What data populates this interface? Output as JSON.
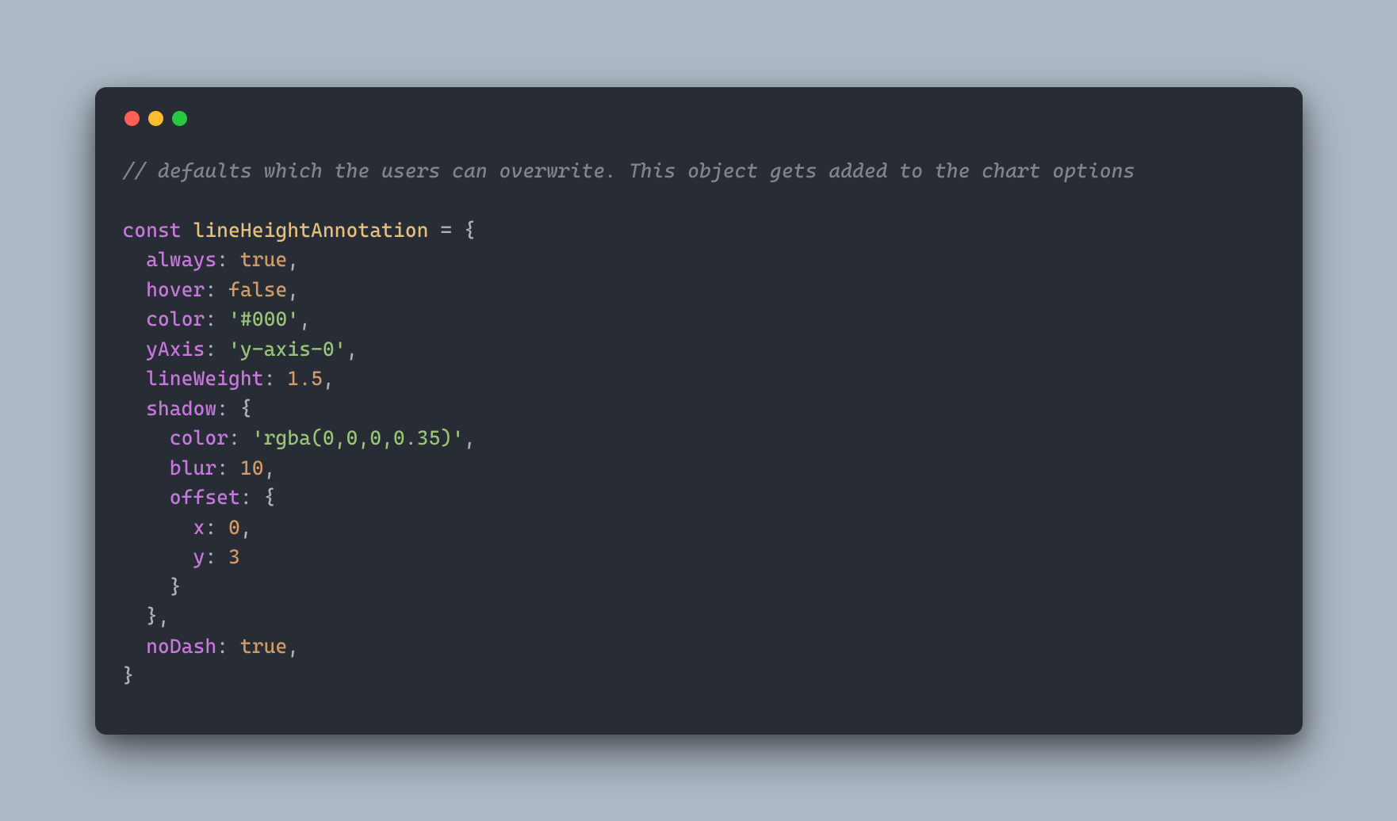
{
  "code": {
    "comment": "// defaults which the users can overwrite. This object gets added to the chart options",
    "kw_const": "const",
    "var_name": "lineHeightAnnotation",
    "eq": " = ",
    "brace_open": "{",
    "brace_close": "}",
    "comma": ",",
    "colon": ": ",
    "props": {
      "always": "always",
      "hover": "hover",
      "color": "color",
      "yAxis": "yAxis",
      "lineWeight": "lineWeight",
      "shadow": "shadow",
      "blur": "blur",
      "offset": "offset",
      "x": "x",
      "y": "y",
      "noDash": "noDash"
    },
    "vals": {
      "true": "true",
      "false": "false",
      "hex000": "'#000'",
      "yaxis0": "'y-axis-0'",
      "n1_5": "1.5",
      "rgba": "'rgba(0,0,0,0.35)'",
      "n10": "10",
      "n0": "0",
      "n3": "3"
    }
  }
}
